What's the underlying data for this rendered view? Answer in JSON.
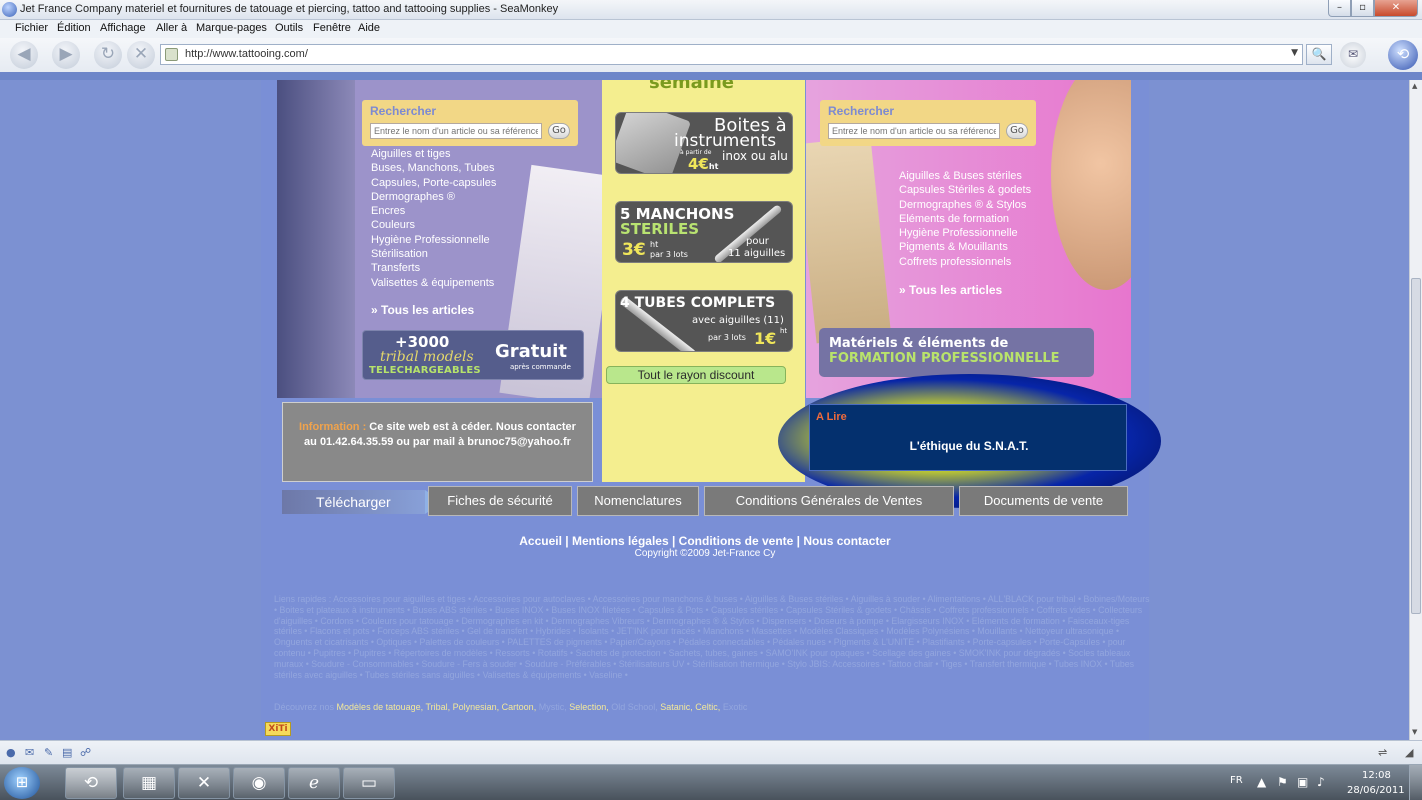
{
  "window": {
    "title": "Jet France Company materiel et fournitures de tatouage et piercing, tattoo and tattooing supplies - SeaMonkey",
    "min_label": "–",
    "max_label": "▫",
    "close_label": "✕"
  },
  "menu": [
    "Fichier",
    "Édition",
    "Affichage",
    "Aller à",
    "Marque-pages",
    "Outils",
    "Fenêtre",
    "Aide"
  ],
  "navbar": {
    "back_icon": "back-arrow-icon",
    "forward_icon": "forward-arrow-icon",
    "reload_icon": "reload-icon",
    "stop_icon": "stop-icon",
    "url": "http://www.tattooing.com/",
    "dropdown_glyph": "▼",
    "search_glyph": "🔍",
    "mail_glyph": "✉",
    "logo_glyph": "⟲"
  },
  "site": {
    "search_left": {
      "label": "Rechercher",
      "placeholder": "Entrez le nom d'un article ou sa référence",
      "go": "Go"
    },
    "search_right": {
      "label": "Rechercher",
      "placeholder": "Entrez le nom d'un article ou sa référence",
      "go": "Go"
    },
    "categories_left": [
      "Aiguilles et tiges",
      "Buses, Manchons, Tubes",
      "Capsules, Porte-capsules",
      "Dermographes ®",
      "Encres",
      "Couleurs",
      "Hygiène Professionnelle",
      "Stérilisation",
      "Transferts",
      "Valisettes & équipements"
    ],
    "tous_left": "» Tous les articles",
    "categories_right": [
      "Aiguilles & Buses stériles",
      "Capsules Stériles & godets",
      "Dermographes ® & Stylos",
      "Eléments de formation",
      "Hygiène Professionnelle",
      "Pigments & Mouillants",
      "Coffrets professionnels"
    ],
    "tous_right": "» Tous les articles",
    "tribal_banner": {
      "line1": "+3000",
      "line2": "tribal models",
      "line3": "TELECHARGEABLES",
      "line4": "Gratuit",
      "line5": "après commande"
    },
    "promo_top": "semaine",
    "promo1": {
      "a": "Boites à",
      "b": "instruments",
      "c": "à partir de",
      "d": "4€",
      "d_unit": "ht",
      "e": "inox ou alu"
    },
    "promo2": {
      "a": "5 MANCHONS",
      "b": "STERILES",
      "c": "3€",
      "d": "ht",
      "e": "par 3 lots",
      "f": "pour",
      "g": "11 aiguilles"
    },
    "promo3": {
      "a": "4 TUBES COMPLETS",
      "b": "avec aiguilles (11)",
      "c": "par 3 lots",
      "d": "1€",
      "e": "ht"
    },
    "discount_button": "Tout le rayon discount",
    "formation_banner": {
      "line1": "Matériels & éléments de",
      "line2": "FORMATION PROFESSIONNELLE"
    },
    "info": {
      "label": "Information :",
      "text": " Ce site web est à céder. Nous contacter au 01.42.64.35.59 ou par mail à brunoc75@yahoo.fr"
    },
    "alire": {
      "heading": "A Lire",
      "link": "L'éthique du S.N.A.T."
    },
    "telecharger": "Télécharger",
    "download_buttons": [
      "Fiches de sécurité",
      "Nomenclatures",
      "Conditions Générales de Ventes",
      "Documents de vente"
    ],
    "footer_links": "Accueil | Mentions légales | Conditions de vente | Nous contacter",
    "copyright": "Copyright ©2009 Jet-France Cy",
    "quicklinks": "Liens rapides : Accessoires pour aiguilles et tiges • Accessoires pour autoclaves • Accessoires pour manchons & buses • Aiguilles & Buses stériles • Aiguilles à souder • Alimentations • ALL'BLACK pour tribal • Bobines/Moteurs • Boites et plateaux à instruments • Buses ABS stériles • Buses INOX • Buses INOX filetées • Capsules & Pots • Capsules stériles • Capsules Stériles & godets • Châssis • Coffrets professionnels • Coffrets vides • Collecteurs d'aiguilles • Cordons • Couleurs pour tatouage • Dermographes en kit • Dermographes Vibreurs • Dermographes ® & Stylos • Dispensers • Doseurs à pompe • Elargisseurs INOX • Eléments de formation • Faisceaux-tiges stériles • Flacons et pots • Forceps ABS stériles • Gel de transfert • Hybrides • Isolants • JET'INK pour tracés • Manchons • Massettes • Modèles Classiques • Modèles Polynésiens • Mouillants • Nettoyeur ultrasonique • Onguents et cicatrisants • Optiques • Palettes de couleurs • PALETTES de pigments • Papier/Crayons • Pédales connectables • Pédales nues • Pigments & L'UNITE • Plastifiants • Porte-capsules • Porte-Capsules • pour contenu • Pupitres • Pupitres • Répertoires de modèles • Ressorts • Rotatifs • Sachets de protection • Sachets, tubes, gaines • SAMO'INK pour opaques • Scellage des gaines • SMOK'INK pour dégradés • Socles tableaux muraux • Soudure - Consommables • Soudure - Fers à souder • Soudure - Préférables • Stérilisateurs UV • Stérilisation thermique • Stylo JBIS: Accessoires • Tattoo chair • Tiges • Transfert thermique • Tubes INOX • Tubes stériles avec aiguilles • Tubes stériles sans aiguilles • Valisettes & équipements • Vaseline •",
    "decouvrez": {
      "prefix": "Découvrez nos",
      "items": [
        {
          "t": "Modèles de tatouage",
          "y": true
        },
        {
          "t": "Tribal",
          "y": true
        },
        {
          "t": "Polynesian",
          "y": true
        },
        {
          "t": "Cartoon",
          "y": true
        },
        {
          "t": "Mystic",
          "y": false
        },
        {
          "t": "Selection",
          "y": true
        },
        {
          "t": "Old School",
          "y": false
        },
        {
          "t": "Satanic",
          "y": true
        },
        {
          "t": "Celtic",
          "y": true
        },
        {
          "t": "Exotic",
          "y": false
        }
      ]
    },
    "xiti": "XiTi"
  },
  "statusbar": {
    "icons": [
      "globe-icon",
      "mail-icon",
      "composer-icon",
      "addressbook-icon",
      "chat-icon"
    ]
  },
  "taskbar": {
    "start_glyph": "⊞",
    "apps": [
      "seamonkey-app",
      "explorer-app",
      "tools-app",
      "gimp-app",
      "ie-app",
      "notepad-app"
    ],
    "lang": "FR",
    "time": "12:08",
    "date": "28/06/2011"
  }
}
